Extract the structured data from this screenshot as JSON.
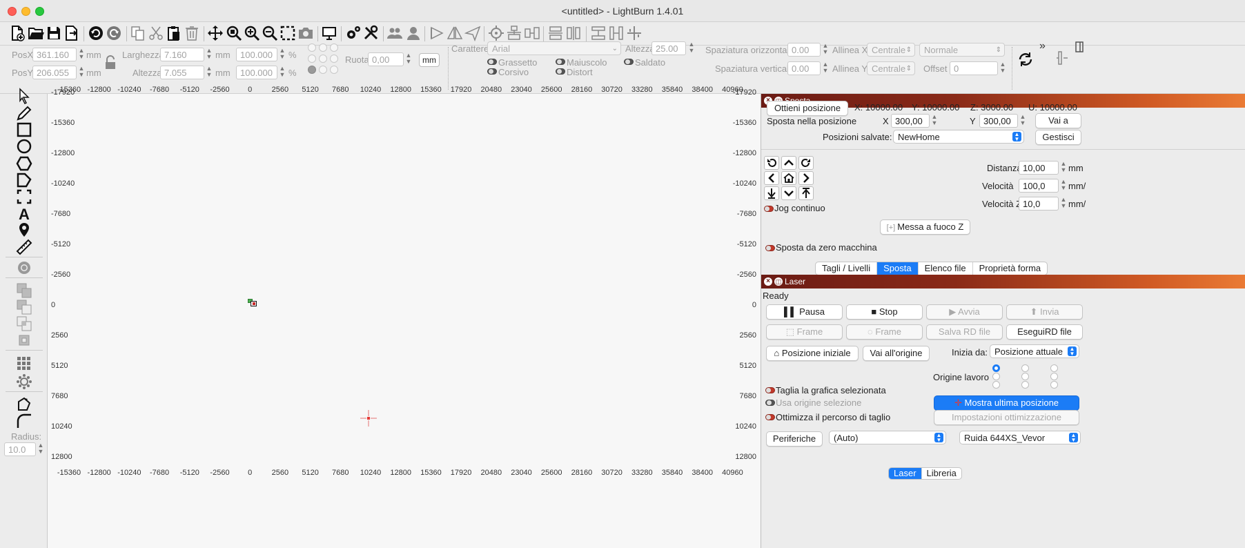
{
  "window": {
    "title": "<untitled> - LightBurn 1.4.01"
  },
  "toolbar": {
    "icons": [
      "new-file-icon",
      "open-file-icon",
      "save-icon",
      "save-as-icon",
      "undo-icon",
      "redo-icon",
      "copy-icon",
      "cut-icon",
      "paste-icon",
      "delete-icon",
      "move-icon",
      "zoom-icon",
      "zoom-in-icon",
      "zoom-out-icon",
      "select-rect-icon",
      "camera-icon",
      "monitor-icon",
      "settings-icon",
      "tools-icon",
      "users-icon",
      "user-icon",
      "mirror-icon",
      "flip-icon",
      "send-icon",
      "target-icon",
      "align-icon",
      "align2-icon",
      "distribute-icon",
      "distribute2-icon",
      "distribute3-icon",
      "distribute4-icon",
      "grid-align-icon"
    ]
  },
  "props": {
    "posx_label": "PosX",
    "posx_value": "361.160",
    "posy_label": "PosY",
    "posy_value": "206.055",
    "unit_mm": "mm",
    "width_label": "Larghezza",
    "width_value": "7.160",
    "height_label": "Altezza",
    "height_value": "7.055",
    "scale_x": "100.000",
    "scale_y": "100.000",
    "percent": "%",
    "rotate_label": "Ruota",
    "rotate_value": "0,00",
    "mm_button": "mm",
    "font_label": "Carattere",
    "font_value": "Arial",
    "font_height_label": "Altezza",
    "font_height_value": "25.00",
    "hspacing_label": "Spaziatura orizzontale",
    "hspacing_value": "0.00",
    "vspacing_label": "Spaziatura verticale",
    "vspacing_value": "0.00",
    "alignx_label": "Allinea X",
    "alignx_value": "Centrale",
    "aligny_label": "Allinea Y",
    "aligny_value": "Centrale",
    "mode_value": "Normale",
    "offset_label": "Offset",
    "offset_value": "0",
    "bold": "Grassetto",
    "uppercase": "Maiuscolo",
    "welded": "Saldato",
    "italic": "Corsivo",
    "distort": "Distort",
    "more": "»"
  },
  "toolbox": {
    "radius_label": "Radius:",
    "radius_value": "10.0"
  },
  "canvas": {
    "x_ticks": [
      "-15360",
      "-12800",
      "-10240",
      "-7680",
      "-5120",
      "-2560",
      "0",
      "2560",
      "5120",
      "7680",
      "10240",
      "12800",
      "15360",
      "17920",
      "20480",
      "23040",
      "25600",
      "28160",
      "30720",
      "33280",
      "35840",
      "38400",
      "40960"
    ],
    "y_ticks": [
      "-17920",
      "-15360",
      "-12800",
      "-10240",
      "-7680",
      "-5120",
      "-2560",
      "0",
      "2560",
      "5120",
      "7680",
      "10240",
      "12800"
    ]
  },
  "move_panel": {
    "title": "Sposta",
    "get_position": "Ottieni posizione",
    "x_readout": "X: 10000.00",
    "y_readout": "Y: 10000.00",
    "z_readout": "Z: 3000.00",
    "u_readout": "U: 10000.00",
    "move_to_label": "Sposta nella posizione",
    "x_label": "X",
    "x_value": "300,00",
    "y_label": "Y",
    "y_value": "300,00",
    "go_to": "Vai a",
    "saved_label": "Posizioni salvate:",
    "saved_value": "NewHome",
    "manage": "Gestisci",
    "distance_label": "Distanza",
    "distance_value": "10,00",
    "distance_unit": "mm",
    "speed_label": "Velocità",
    "speed_value": "100,0",
    "speed_unit": "mm/",
    "zspeed_label": "Velocità Z",
    "zspeed_value": "10,0",
    "zspeed_unit": "mm/",
    "jog_continuous": "Jog continuo",
    "focus_z": "Messa a fuoco Z",
    "move_from_zero": "Sposta da zero macchina",
    "tabs": [
      "Tagli / Livelli",
      "Sposta",
      "Elenco file",
      "Proprietà forma"
    ]
  },
  "laser_panel": {
    "title": "Laser",
    "status": "Ready",
    "pause": "Pausa",
    "stop": "Stop",
    "start": "Avvia",
    "send": "Invia",
    "frame1": "Frame",
    "frame2": "Frame",
    "save_rd": "Salva RD file",
    "run_rd": "EseguiRD file",
    "home": "Posizione iniziale",
    "go_origin": "Vai all'origine",
    "start_from_label": "Inizia da:",
    "start_from_value": "Posizione attuale",
    "job_origin_label": "Origine lavoro",
    "cut_selected": "Taglia la grafica selezionata",
    "use_selection_origin": "Usa origine selezione",
    "show_last_pos": "Mostra ultima posizione",
    "optimize_path": "Ottimizza il percorso di taglio",
    "opt_settings": "Impostazioni ottimizzazione",
    "devices": "Periferiche",
    "port_value": "(Auto)",
    "device_value": "Ruida 644XS_Vevor",
    "bottom_tabs": [
      "Laser",
      "Libreria"
    ]
  },
  "colors": {
    "accent": "#1b7cf6",
    "dock_header": "#8a2a18"
  }
}
